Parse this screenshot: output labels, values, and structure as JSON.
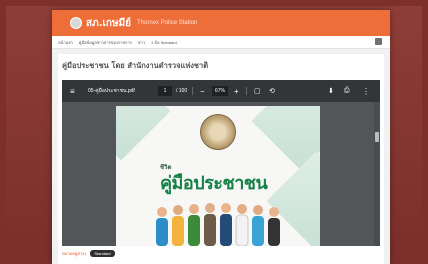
{
  "header": {
    "brand": "สภ.เกษมีย์",
    "station_name": "Thornex Police Station",
    "brand_color": "#ee6e3a"
  },
  "breadcrumb": {
    "items": [
      "หน้าแรก",
      "คู่มือข้อมูลข่าวสารของราชการ",
      "ข่าว",
      "1 ข้อ Standard"
    ]
  },
  "page": {
    "title": "คู่มือประชาชน โดย สำนักงานตำรวจแห่งชาติ"
  },
  "pdf_viewer": {
    "filename": "05-คู่มือประชาชน.pdf",
    "current_page": "1",
    "page_total": "/ 100",
    "zoom": "67%",
    "icons": {
      "menu": "menu-icon",
      "zoom_out": "minus-icon",
      "zoom_in": "plus-icon",
      "fit": "fit-page-icon",
      "rotate": "rotate-icon",
      "download": "download-icon",
      "print": "print-icon",
      "more": "more-vert-icon"
    }
  },
  "cover": {
    "small_text": "ชีวิต",
    "title": "คู่มือประชาชน"
  },
  "footer": {
    "category": "หมวดหมู่ต่างๆ",
    "tag": "Standard"
  }
}
